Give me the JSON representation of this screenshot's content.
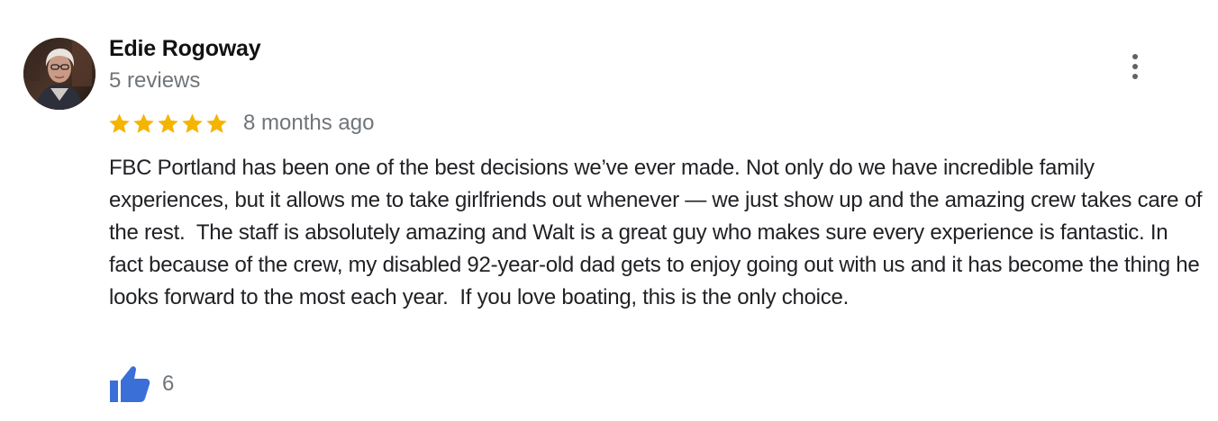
{
  "review": {
    "reviewer_name": "Edie Rogoway",
    "review_count": "5 reviews",
    "rating": 5,
    "rating_max": 5,
    "date": "8 months ago",
    "text": "FBC Portland has been one of the best decisions we’ve ever made. Not only do we have incredible family experiences, but it allows me to take girlfriends out whenever — we just show up and the amazing crew takes care of the rest.  The staff is absolutely amazing and Walt is a great guy who makes sure every experience is fantastic. In fact because of the crew, my disabled 92-year-old dad gets to enjoy going out with us and it has become the thing he looks forward to the most each year.  If you love boating, this is the only choice.",
    "likes": "6"
  },
  "icons": {
    "avatar": "profile-photo",
    "menu": "more-vert-icon",
    "star": "star-icon",
    "like": "thumbs-up-icon"
  },
  "colors": {
    "star": "#f4b400",
    "like": "#3b6fd8",
    "secondary_text": "#70757a",
    "menu_dots": "#5f6368"
  }
}
